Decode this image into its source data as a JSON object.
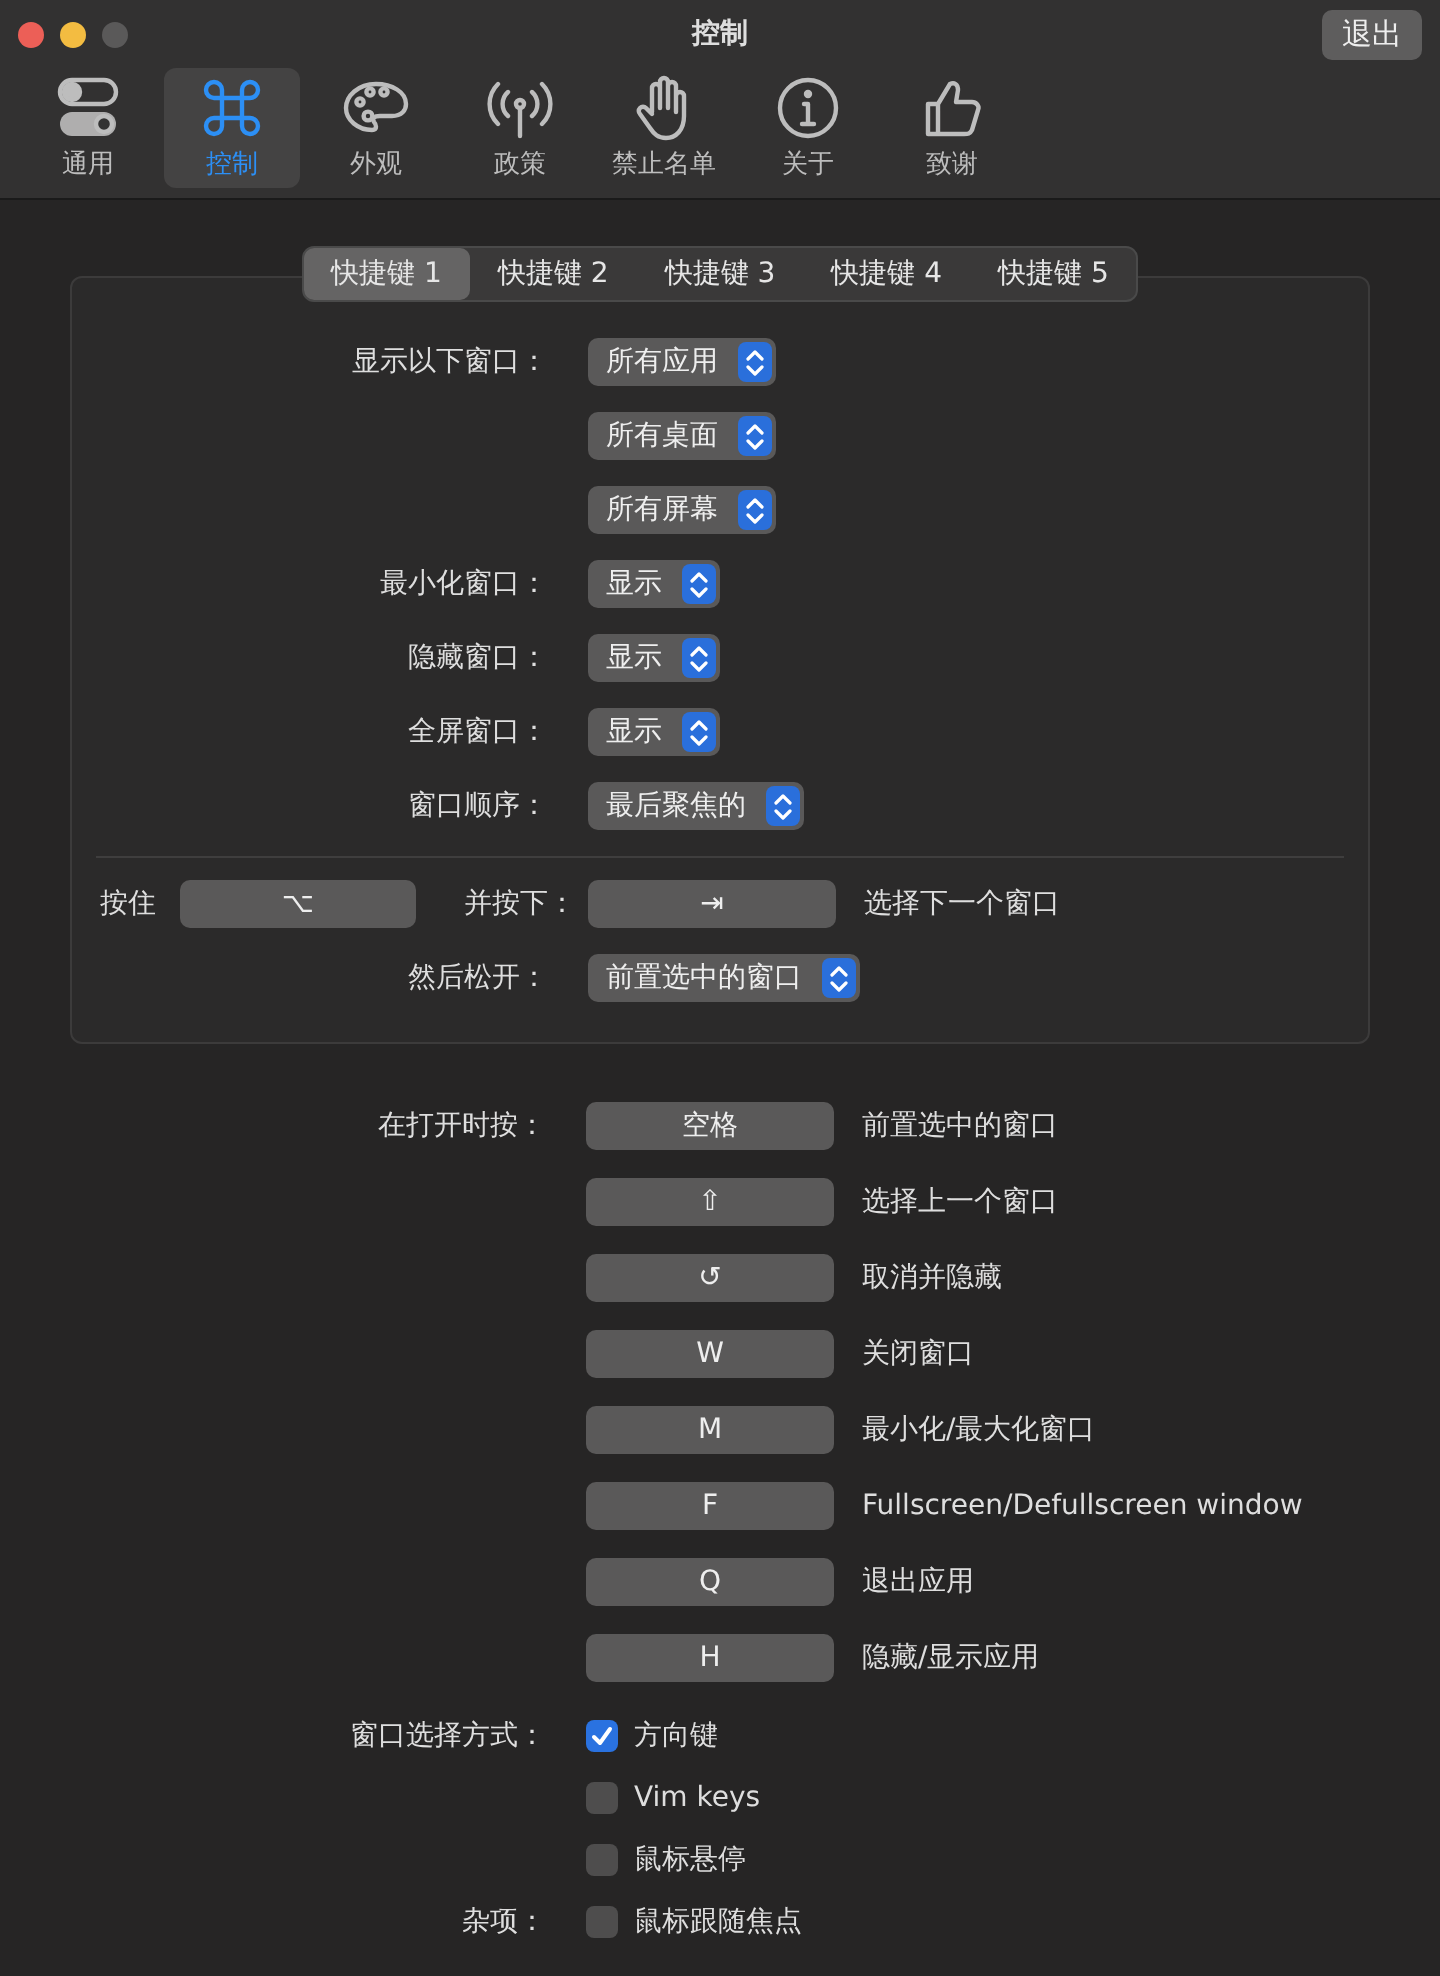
{
  "window": {
    "title": "控制",
    "quit_button": "退出"
  },
  "toolbar": [
    {
      "label": "通用",
      "selected": false
    },
    {
      "label": "控制",
      "selected": true
    },
    {
      "label": "外观",
      "selected": false
    },
    {
      "label": "政策",
      "selected": false
    },
    {
      "label": "禁止名单",
      "selected": false
    },
    {
      "label": "关于",
      "selected": false
    },
    {
      "label": "致谢",
      "selected": false
    }
  ],
  "tabs": [
    {
      "label": "快捷键 1",
      "selected": true
    },
    {
      "label": "快捷键 2",
      "selected": false
    },
    {
      "label": "快捷键 3",
      "selected": false
    },
    {
      "label": "快捷键 4",
      "selected": false
    },
    {
      "label": "快捷键 5",
      "selected": false
    }
  ],
  "window_options": [
    {
      "label": "显示以下窗口：",
      "value": "所有应用"
    },
    {
      "value": "所有桌面"
    },
    {
      "value": "所有屏幕"
    },
    {
      "label": "最小化窗口：",
      "value": "显示"
    },
    {
      "label": "隐藏窗口：",
      "value": "显示"
    },
    {
      "label": "全屏窗口：",
      "value": "显示"
    },
    {
      "label": "窗口顺序：",
      "value": "最后聚焦的"
    }
  ],
  "trigger": {
    "hold_label": "按住",
    "hold_key": "⌥",
    "press_label": "并按下：",
    "press_key": "⇥",
    "press_action": "选择下一个窗口",
    "release_label": "然后松开：",
    "release_value": "前置选中的窗口"
  },
  "open_shortcuts": {
    "label": "在打开时按：",
    "items": [
      {
        "key": "空格",
        "action": "前置选中的窗口"
      },
      {
        "key": "⇧",
        "action": "选择上一个窗口"
      },
      {
        "key": "↺",
        "action": "取消并隐藏"
      },
      {
        "key": "W",
        "action": "关闭窗口"
      },
      {
        "key": "M",
        "action": "最小化/最大化窗口"
      },
      {
        "key": "F",
        "action": "Fullscreen/Defullscreen window"
      },
      {
        "key": "Q",
        "action": "退出应用"
      },
      {
        "key": "H",
        "action": "隐藏/显示应用"
      }
    ]
  },
  "checkbox_groups": [
    {
      "label": "窗口选择方式：",
      "items": [
        {
          "label": "方向键",
          "checked": true
        },
        {
          "label": "Vim keys",
          "checked": false
        },
        {
          "label": "鼠标悬停",
          "checked": false
        }
      ]
    },
    {
      "label": "杂项：",
      "items": [
        {
          "label": "鼠标跟随焦点",
          "checked": false
        }
      ]
    }
  ]
}
